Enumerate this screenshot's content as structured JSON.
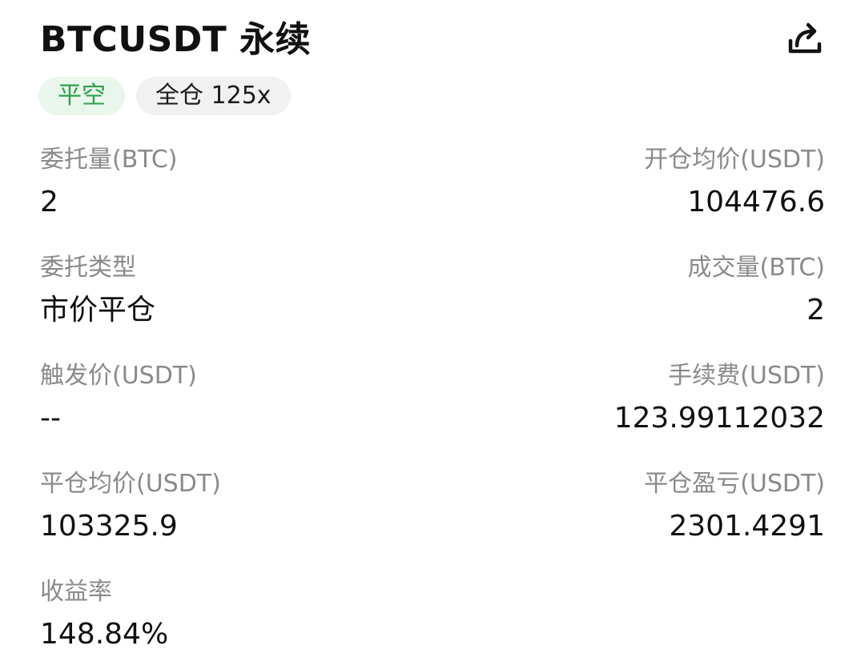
{
  "header": {
    "title": "BTCUSDT 永续",
    "share_icon": "share-icon"
  },
  "tags": {
    "direction": "平空",
    "margin": "全仓 125x"
  },
  "colors": {
    "direction_text": "#2fa04a",
    "direction_bg": "#e9f6ec",
    "label_text": "#8a8a8a",
    "value_text": "#111111"
  },
  "fields": {
    "order_qty": {
      "label": "委托量(BTC)",
      "value": "2"
    },
    "open_avg_price": {
      "label": "开仓均价(USDT)",
      "value": "104476.6"
    },
    "order_type": {
      "label": "委托类型",
      "value": "市价平仓"
    },
    "filled_qty": {
      "label": "成交量(BTC)",
      "value": "2"
    },
    "trigger_price": {
      "label": "触发价(USDT)",
      "value": "--"
    },
    "fee": {
      "label": "手续费(USDT)",
      "value": "123.99112032"
    },
    "close_avg_price": {
      "label": "平仓均价(USDT)",
      "value": "103325.9"
    },
    "close_pnl": {
      "label": "平仓盈亏(USDT)",
      "value": "2301.4291"
    },
    "roi": {
      "label": "收益率",
      "value": "148.84%"
    }
  }
}
